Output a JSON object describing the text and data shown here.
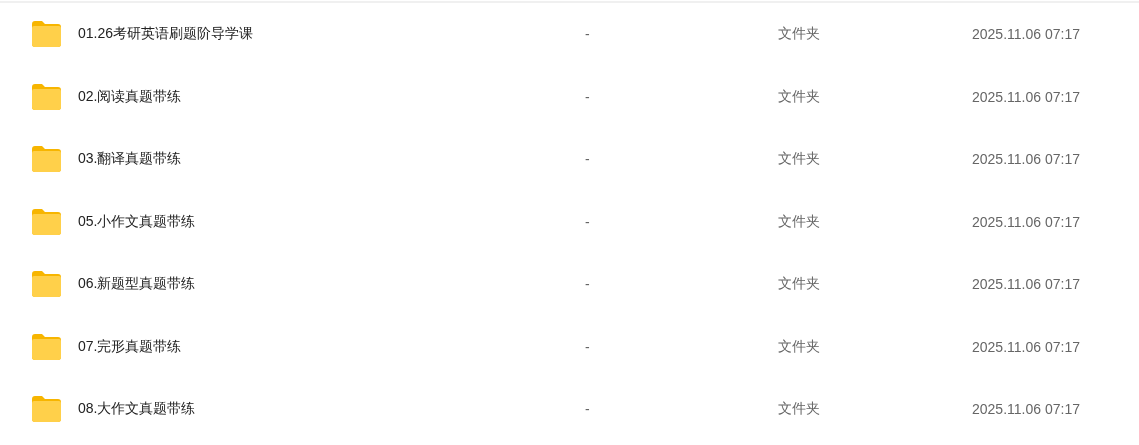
{
  "files": [
    {
      "name": "01.26考研英语刷题阶导学课",
      "size": "-",
      "type": "文件夹",
      "modified": "2025.11.06 07:17"
    },
    {
      "name": "02.阅读真题带练",
      "size": "-",
      "type": "文件夹",
      "modified": "2025.11.06 07:17"
    },
    {
      "name": "03.翻译真题带练",
      "size": "-",
      "type": "文件夹",
      "modified": "2025.11.06 07:17"
    },
    {
      "name": "05.小作文真题带练",
      "size": "-",
      "type": "文件夹",
      "modified": "2025.11.06 07:17"
    },
    {
      "name": "06.新题型真题带练",
      "size": "-",
      "type": "文件夹",
      "modified": "2025.11.06 07:17"
    },
    {
      "name": "07.完形真题带练",
      "size": "-",
      "type": "文件夹",
      "modified": "2025.11.06 07:17"
    },
    {
      "name": "08.大作文真题带练",
      "size": "-",
      "type": "文件夹",
      "modified": "2025.11.06 07:17"
    }
  ]
}
